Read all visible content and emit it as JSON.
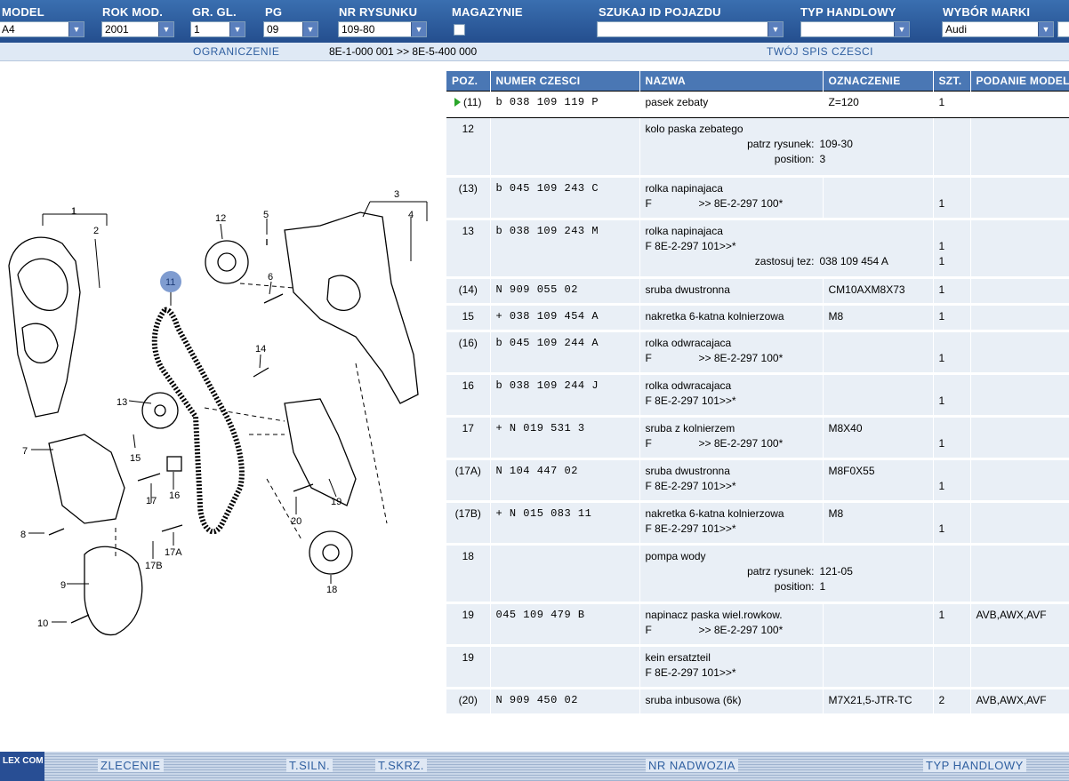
{
  "filters": {
    "model": {
      "label": "MODEL",
      "value": "A4"
    },
    "rok_mod": {
      "label": "ROK MOD.",
      "value": "2001"
    },
    "gr_gl": {
      "label": "GR. GL.",
      "value": "1"
    },
    "pg": {
      "label": "PG",
      "value": "09"
    },
    "nr_rysunku": {
      "label": "NR RYSUNKU",
      "value": "109-80"
    },
    "magazynie": {
      "label": "MAGAZYNIE"
    },
    "szukaj": {
      "label": "SZUKAJ ID POJAZDU",
      "value": ""
    },
    "typ_handlowy": {
      "label": "TYP HANDLOWY",
      "value": ""
    },
    "wybor_marki": {
      "label": "WYBÓR MARKI",
      "value": "Audi"
    }
  },
  "subbar": {
    "ograniczenie_label": "OGRANICZENIE",
    "ograniczenie_value": "8E-1-000 001 >> 8E-5-400 000",
    "twoj_spis": "TWÓJ SPIS CZESCI"
  },
  "table": {
    "headers": [
      "POZ.",
      "NUMER CZESCI",
      "NAZWA",
      "OZNACZENIE",
      "SZT.",
      "PODANIE MODELU"
    ],
    "rows": [
      {
        "poz": "(11)",
        "numer": "b  038  109  119  P",
        "nazwa": "pasek zebaty",
        "oznaczenie": "Z=120",
        "szt": "1",
        "podanie": ""
      },
      {
        "poz": "12",
        "numer": "",
        "nazwa": "kolo paska zebatego",
        "sub_lab_1": "patrz rysunek:",
        "sub_val_1": "109-30",
        "sub_lab_2": "position:",
        "sub_val_2": "3"
      },
      {
        "poz": "(13)",
        "numer": "b  045  109  243  C",
        "nazwa": "rolka napinajaca",
        "line2_a": "F",
        "line2_b": ">> 8E-2-297 100*",
        "szt": "1"
      },
      {
        "poz": "13",
        "numer": "b  038  109  243  M",
        "nazwa": "rolka napinajaca",
        "line2": "F 8E-2-297 101>>*",
        "zast_lab": "zastosuj tez:",
        "zast_val": "038 109 454 A",
        "szt": "1",
        "szt2": "1"
      },
      {
        "poz": "(14)",
        "numer": "   N    909  055  02",
        "nazwa": "sruba dwustronna",
        "oznaczenie": "CM10AXM8X73",
        "szt": "1"
      },
      {
        "poz": "15",
        "numer": "+  038  109  454  A",
        "nazwa": "nakretka 6-katna kolnierzowa",
        "oznaczenie": "M8",
        "szt": "1"
      },
      {
        "poz": "(16)",
        "numer": "b  045  109  244  A",
        "nazwa": "rolka odwracajaca",
        "line2_a": "F",
        "line2_b": ">> 8E-2-297 100*",
        "szt": "1"
      },
      {
        "poz": "16",
        "numer": "b  038  109  244  J",
        "nazwa": "rolka odwracajaca",
        "line2": "F 8E-2-297 101>>*",
        "szt": "1"
      },
      {
        "poz": "17",
        "numer": "+  N    019  531  3",
        "nazwa": "sruba z kolnierzem",
        "line2_a": "F",
        "line2_b": ">> 8E-2-297 100*",
        "oznaczenie": "M8X40",
        "szt": "1"
      },
      {
        "poz": "(17A)",
        "numer": "   N    104  447  02",
        "nazwa": "sruba dwustronna",
        "line2": "F 8E-2-297 101>>*",
        "oznaczenie": "M8F0X55",
        "szt": "1"
      },
      {
        "poz": "(17B)",
        "numer": "+  N    015  083  11",
        "nazwa": "nakretka 6-katna kolnierzowa",
        "line2": "F 8E-2-297 101>>*",
        "oznaczenie": "M8",
        "szt": "1"
      },
      {
        "poz": "18",
        "numer": "",
        "nazwa": "pompa wody",
        "sub_lab_1": "patrz rysunek:",
        "sub_val_1": "121-05",
        "sub_lab_2": "position:",
        "sub_val_2": "1"
      },
      {
        "poz": "19",
        "numer": "   045  109  479  B",
        "nazwa": "napinacz paska wiel.rowkow.",
        "line2_a": "F",
        "line2_b": ">> 8E-2-297 100*",
        "szt": "1",
        "podanie": "AVB,AWX,AVF"
      },
      {
        "poz": "19",
        "numer": "",
        "nazwa": "kein ersatzteil",
        "line2": "F 8E-2-297 101>>*"
      },
      {
        "poz": "(20)",
        "numer": "   N    909  450  02",
        "nazwa": "sruba inbusowa (6k)",
        "oznaczenie": "M7X21,5-JTR-TC",
        "szt": "2",
        "podanie": "AVB,AWX,AVF"
      }
    ]
  },
  "diagram": {
    "callouts": [
      "1",
      "2",
      "3",
      "4",
      "5",
      "6",
      "7",
      "8",
      "9",
      "10",
      "11",
      "12",
      "13",
      "14",
      "15",
      "16",
      "17",
      "17A",
      "17B",
      "18",
      "19",
      "20"
    ]
  },
  "bottombar": {
    "logo": "LEX COM",
    "zlecenie": "ZLECENIE",
    "t_siln": "T.SILN.",
    "t_skrz": "T.SKRZ.",
    "nr_nadwozia": "NR NADWOZIA",
    "typ_handlowy": "TYP HANDLOWY"
  },
  "colors": {
    "accent": "#4a77b4",
    "row_bg": "#e9eff6",
    "selected_marker": "#2aa62a"
  }
}
